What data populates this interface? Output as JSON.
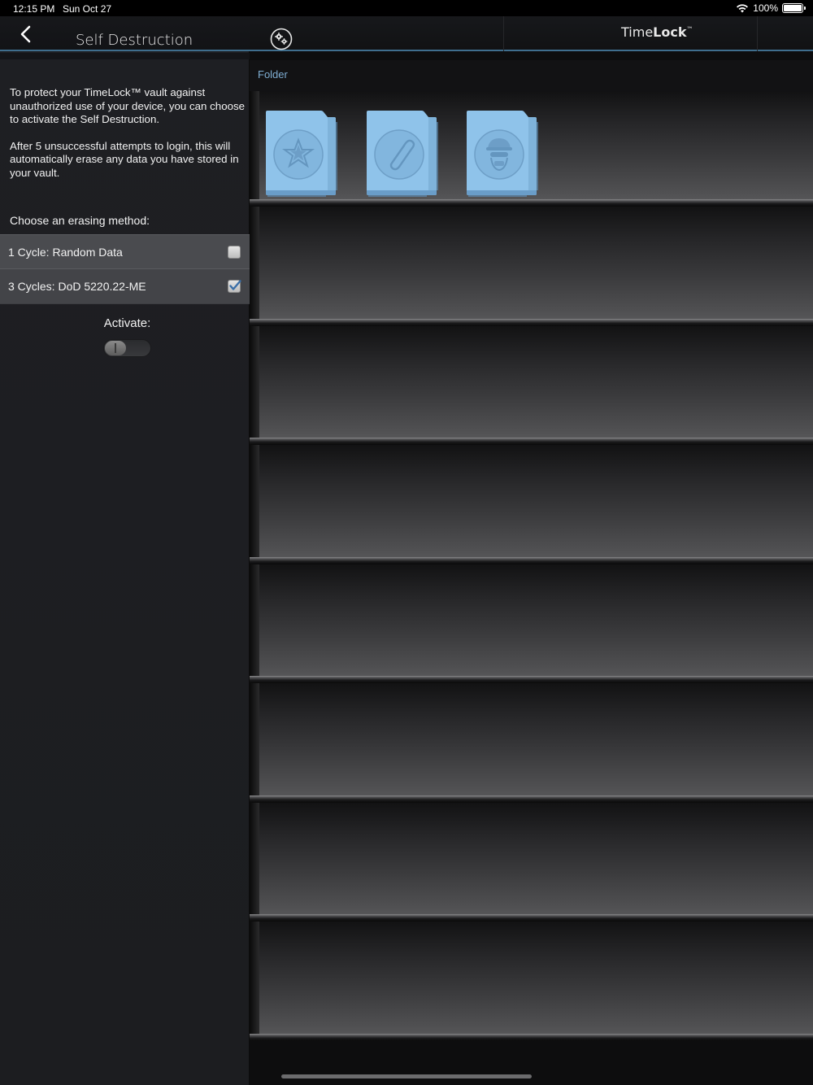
{
  "status_bar": {
    "time": "12:15 PM",
    "date": "Sun Oct 27",
    "battery": "100%"
  },
  "left_panel": {
    "title": "Self Destruction",
    "intro_1": "To protect your TimeLock™ vault against unauthorized use of your device, you can choose to activate the Self Destruction.",
    "intro_2": "After 5 unsuccessful attempts to login, this will automatically erase any data you have stored in your vault.",
    "choose_label": "Choose an erasing method:",
    "methods": [
      {
        "label": "1 Cycle: Random Data",
        "checked": false
      },
      {
        "label": "3 Cycles: DoD 5220.22-ME",
        "checked": true
      }
    ],
    "activate_label": "Activate:",
    "activate_on": false
  },
  "right_panel": {
    "app_title_light": "Time",
    "app_title_bold": "Lock",
    "app_title_mark": "™",
    "folder_label": "Folder",
    "folders": [
      {
        "icon": "star-icon"
      },
      {
        "icon": "paperclip-icon"
      },
      {
        "icon": "agent-icon"
      }
    ]
  },
  "colors": {
    "accent_line": "#3f6e8d",
    "folder_blue": "#8fc3ea",
    "folder_label": "#7faed3",
    "checkbox_tick": "#3b6fa8"
  }
}
